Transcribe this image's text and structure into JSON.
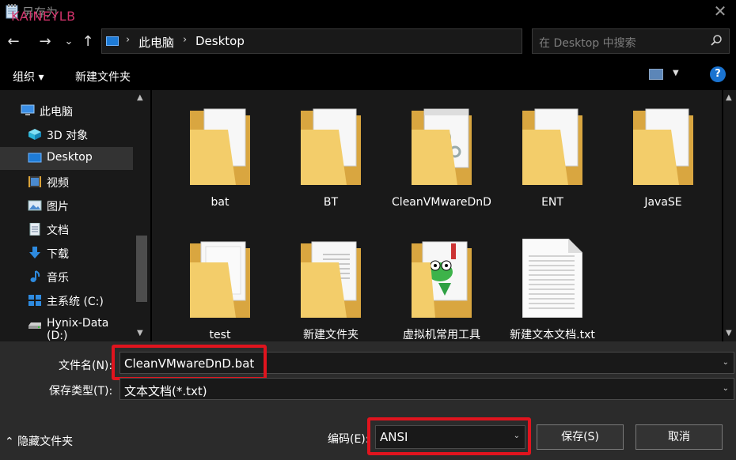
{
  "window": {
    "title": "另存为",
    "watermark": "KAINEYLB",
    "close_glyph": "✕"
  },
  "nav": {
    "back_glyph": "←",
    "forward_glyph": "→",
    "history_glyph": "⌄",
    "up_glyph": "↑",
    "breadcrumb": [
      "此电脑",
      "Desktop"
    ],
    "separator": "›",
    "dropdown_glyph": "⌄",
    "refresh_glyph": "↻",
    "search_placeholder": "在 Desktop 中搜索"
  },
  "toolbar": {
    "organize": "组织 ▾",
    "new_folder": "新建文件夹",
    "help": "?",
    "view_dropdown": "▼"
  },
  "sidebar": {
    "items": [
      {
        "label": "此电脑",
        "icon": "computer-icon"
      },
      {
        "label": "3D 对象",
        "icon": "cube-3d-icon"
      },
      {
        "label": "Desktop",
        "icon": "desktop-icon"
      },
      {
        "label": "视频",
        "icon": "video-icon"
      },
      {
        "label": "图片",
        "icon": "picture-icon"
      },
      {
        "label": "文档",
        "icon": "document-icon"
      },
      {
        "label": "下载",
        "icon": "download-icon"
      },
      {
        "label": "音乐",
        "icon": "music-icon"
      },
      {
        "label": "主系统 (C:)",
        "icon": "windows-drive-icon"
      },
      {
        "label": "Hynix-Data (D:)",
        "icon": "drive-icon"
      }
    ],
    "selected": "Desktop",
    "scroll_up": "▲",
    "scroll_down": "▼"
  },
  "files": [
    {
      "name": "bat",
      "type": "folder",
      "icon": "folder-md-icon"
    },
    {
      "name": "BT",
      "type": "folder",
      "icon": "folder-doc-icon"
    },
    {
      "name": "CleanVMwareDnD",
      "type": "folder",
      "icon": "folder-gears-icon"
    },
    {
      "name": "ENT",
      "type": "folder",
      "icon": "folder-image-icon"
    },
    {
      "name": "JavaSE",
      "type": "folder",
      "icon": "folder-docs-icon"
    },
    {
      "name": "test",
      "type": "folder",
      "icon": "folder-pages-icon"
    },
    {
      "name": "新建文件夹",
      "type": "folder",
      "icon": "folder-text-icon"
    },
    {
      "name": "虚拟机常用工具",
      "type": "folder",
      "icon": "folder-frog-icon"
    },
    {
      "name": "新建文本文档.txt",
      "type": "file",
      "icon": "text-file-icon"
    }
  ],
  "content_scroll": {
    "up": "▲",
    "down": "▼"
  },
  "form": {
    "filename_label": "文件名(N):",
    "filename_value": "CleanVMwareDnD.bat",
    "filetype_label": "保存类型(T):",
    "filetype_value": "文本文档(*.txt)",
    "encoding_label": "编码(E):",
    "encoding_value": "ANSI",
    "save_button": "保存(S)",
    "cancel_button": "取消",
    "hide_folders": "⌃  隐藏文件夹",
    "chevron": "⌄"
  },
  "colors": {
    "highlight": "#e0141e",
    "folder": "#f2c75c",
    "background": "#191919"
  }
}
